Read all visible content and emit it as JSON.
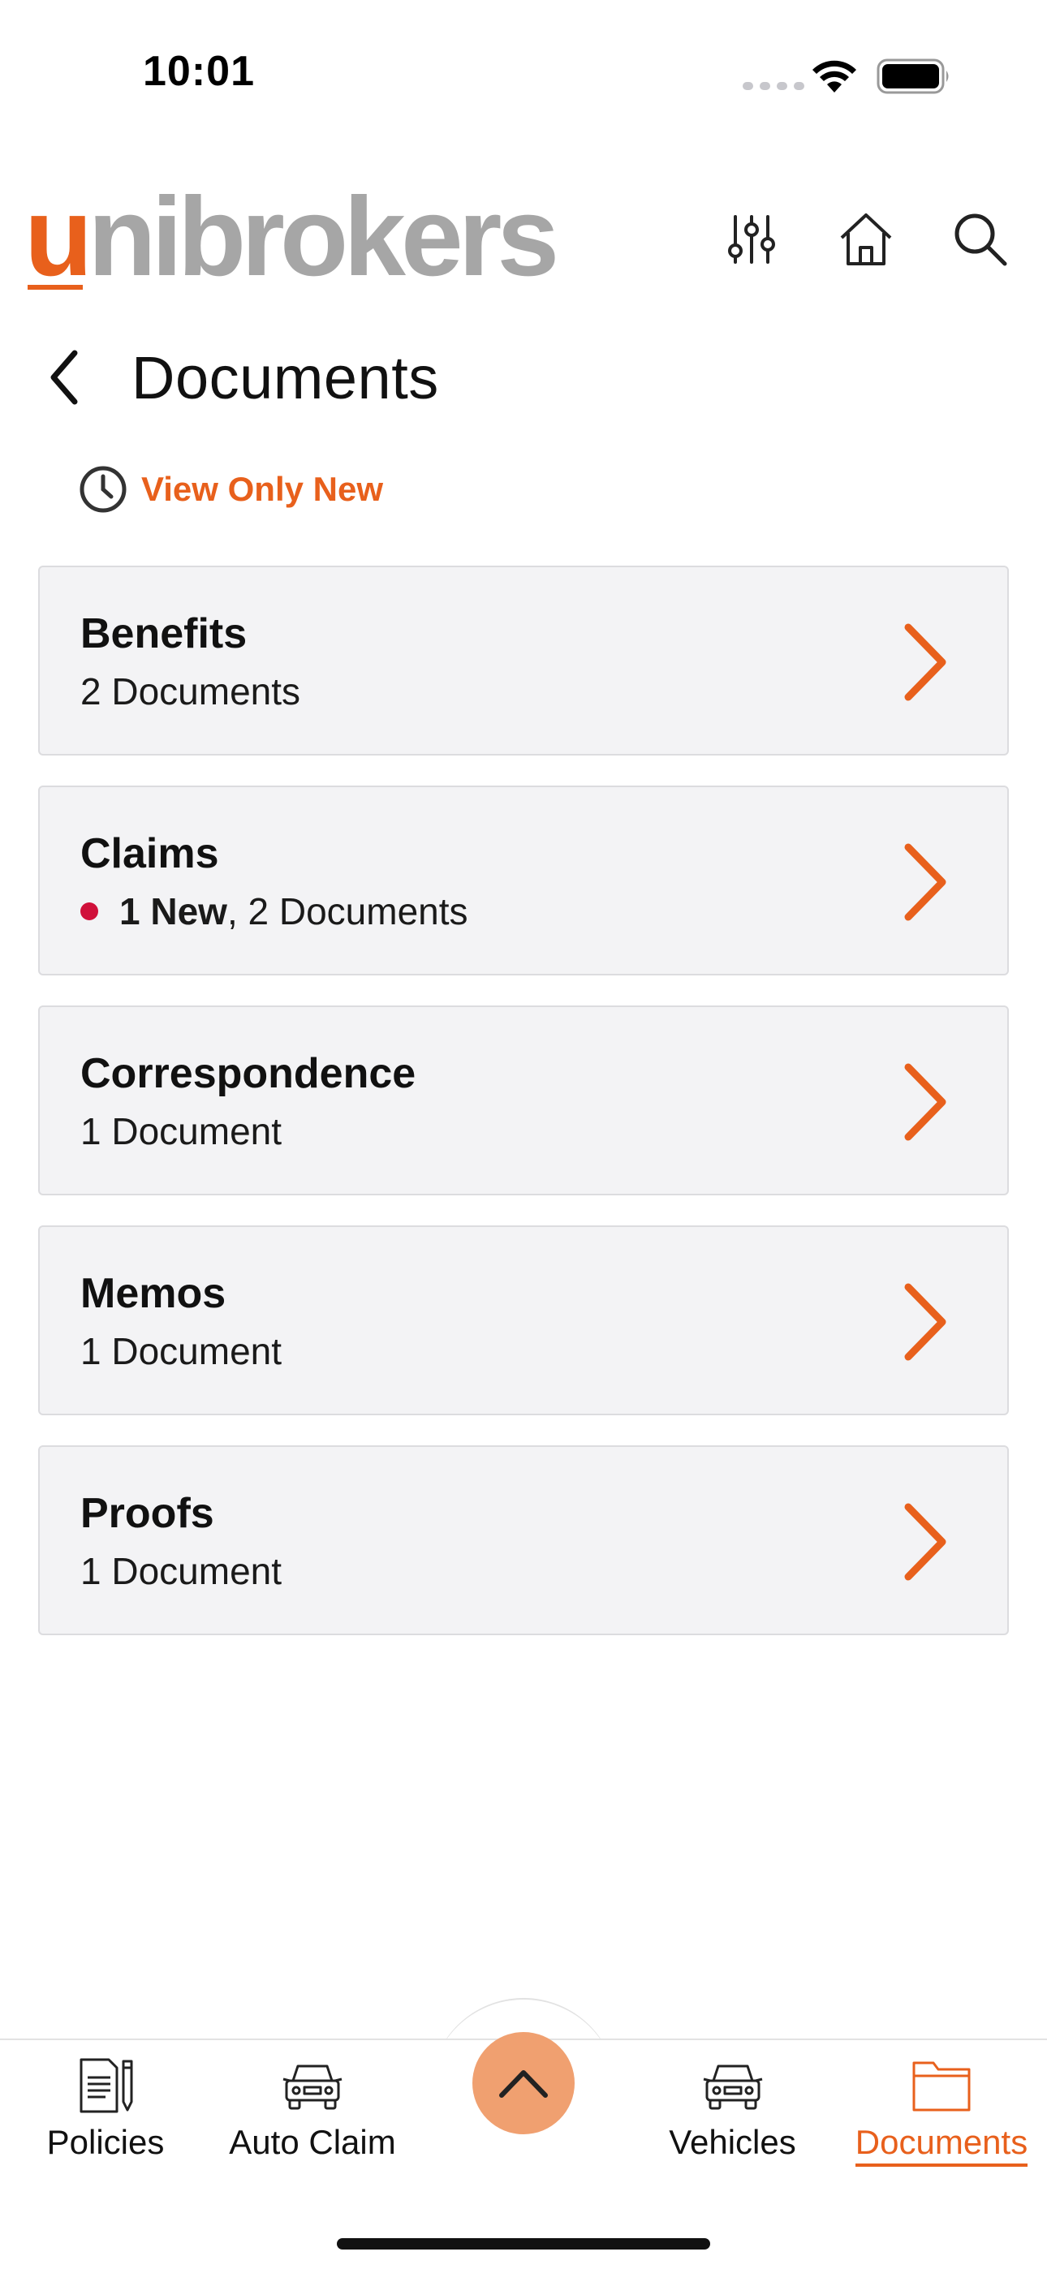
{
  "status_bar": {
    "time": "10:01",
    "icons": [
      "signal-dots-icon",
      "wifi-icon",
      "battery-icon"
    ]
  },
  "header": {
    "logo": {
      "accent": "u",
      "rest": "nibrokers"
    },
    "icons": [
      "sliders-icon",
      "home-icon",
      "search-icon"
    ]
  },
  "page": {
    "title": "Documents",
    "back_icon": "chevron-left-icon"
  },
  "filter": {
    "icon": "clock-icon",
    "label": "View Only New"
  },
  "categories": [
    {
      "title": "Benefits",
      "new_count": "",
      "sub": "2 Documents"
    },
    {
      "title": "Claims",
      "new_count": "1 New",
      "sub": ", 2 Documents"
    },
    {
      "title": "Correspondence",
      "new_count": "",
      "sub": "1 Document"
    },
    {
      "title": "Memos",
      "new_count": "",
      "sub": "1 Document"
    },
    {
      "title": "Proofs",
      "new_count": "",
      "sub": "1 Document"
    }
  ],
  "bottom_nav": {
    "items": [
      {
        "label": "Policies",
        "icon": "policy-document-icon"
      },
      {
        "label": "Auto Claim",
        "icon": "car-icon"
      },
      {
        "label": "Vehicles",
        "icon": "car-icon"
      },
      {
        "label": "Documents",
        "icon": "folder-icon",
        "active": true
      }
    ],
    "fab_icon": "chevron-up-icon"
  },
  "colors": {
    "accent": "#e8601c",
    "logo_gray": "#a6a6a6",
    "card_bg": "#f3f3f5",
    "new_dot": "#d0103a",
    "fab_bg": "#f0a070"
  }
}
